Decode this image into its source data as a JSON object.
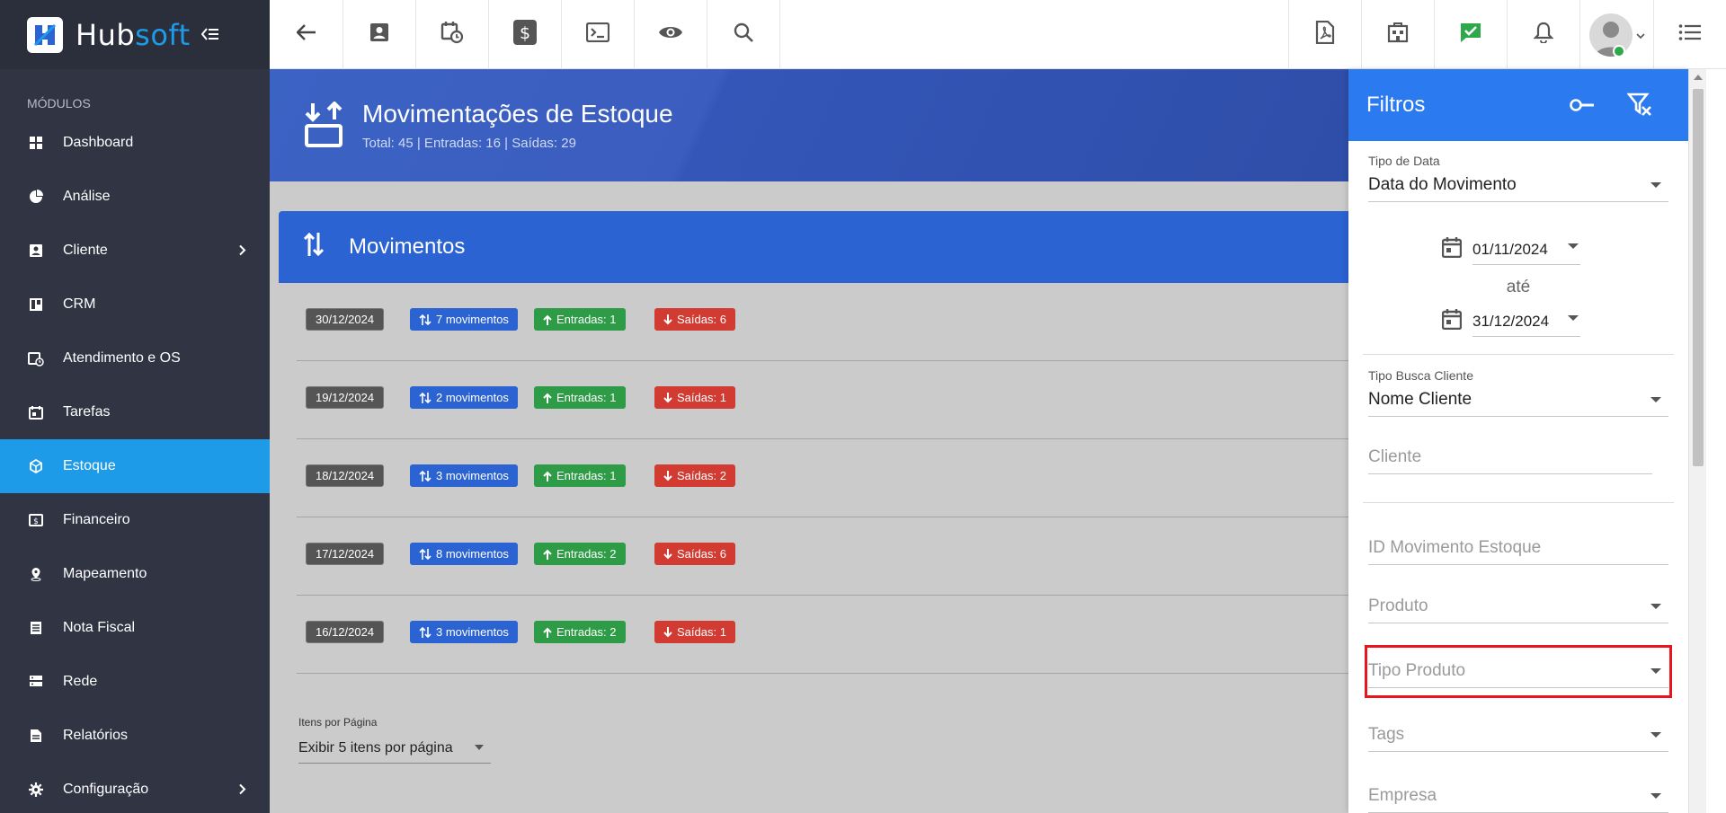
{
  "brand": {
    "hub": "Hub",
    "soft": "soft"
  },
  "sidebar": {
    "section_label": "MÓDULOS",
    "items": [
      {
        "label": "Dashboard",
        "icon": "dashboard-icon"
      },
      {
        "label": "Análise",
        "icon": "pie-chart-icon"
      },
      {
        "label": "Cliente",
        "icon": "contact-card-icon"
      },
      {
        "label": "CRM",
        "icon": "kanban-icon"
      },
      {
        "label": "Atendimento e OS",
        "icon": "calendar-clock-icon"
      },
      {
        "label": "Tarefas",
        "icon": "calendar-tasks-icon"
      },
      {
        "label": "Estoque",
        "icon": "cube-icon",
        "active": true
      },
      {
        "label": "Financeiro",
        "icon": "money-icon"
      },
      {
        "label": "Mapeamento",
        "icon": "map-pin-icon"
      },
      {
        "label": "Nota Fiscal",
        "icon": "document-icon"
      },
      {
        "label": "Rede",
        "icon": "server-icon"
      },
      {
        "label": "Relatórios",
        "icon": "report-icon"
      },
      {
        "label": "Configuração",
        "icon": "gear-icon"
      }
    ]
  },
  "page": {
    "title": "Movimentações de Estoque",
    "subtitle": "Total: 45 | Entradas: 16 | Saídas: 29"
  },
  "card": {
    "title": "Movimentos",
    "rows": [
      {
        "date": "30/12/2024",
        "movimentos": "7 movimentos",
        "entradas": "Entradas: 1",
        "saidas": "Saídas: 6"
      },
      {
        "date": "19/12/2024",
        "movimentos": "2 movimentos",
        "entradas": "Entradas: 1",
        "saidas": "Saídas: 1"
      },
      {
        "date": "18/12/2024",
        "movimentos": "3 movimentos",
        "entradas": "Entradas: 1",
        "saidas": "Saídas: 2"
      },
      {
        "date": "17/12/2024",
        "movimentos": "8 movimentos",
        "entradas": "Entradas: 2",
        "saidas": "Saídas: 6"
      },
      {
        "date": "16/12/2024",
        "movimentos": "3 movimentos",
        "entradas": "Entradas: 2",
        "saidas": "Saídas: 1"
      }
    ],
    "pager_label": "Itens por Página",
    "pager_value": "Exibir 5 itens por página"
  },
  "filters": {
    "title": "Filtros",
    "tipo_data_label": "Tipo de Data",
    "tipo_data_value": "Data do Movimento",
    "date_from": "01/11/2024",
    "ate": "até",
    "date_to": "31/12/2024",
    "tipo_busca_label": "Tipo Busca Cliente",
    "tipo_busca_value": "Nome Cliente",
    "cliente_placeholder": "Cliente",
    "id_mov_placeholder": "ID Movimento Estoque",
    "produto_placeholder": "Produto",
    "tipo_produto_placeholder": "Tipo Produto",
    "tags_placeholder": "Tags",
    "empresa_placeholder": "Empresa"
  },
  "colors": {
    "sidebar_bg": "#303443",
    "active": "#1e9be8",
    "banner": "#3b5dbf",
    "card_header": "#2b63d3",
    "filter_header": "#2b7af0",
    "badge_green": "#2e9b46",
    "badge_red": "#d23b32",
    "highlight": "#e8141e"
  }
}
